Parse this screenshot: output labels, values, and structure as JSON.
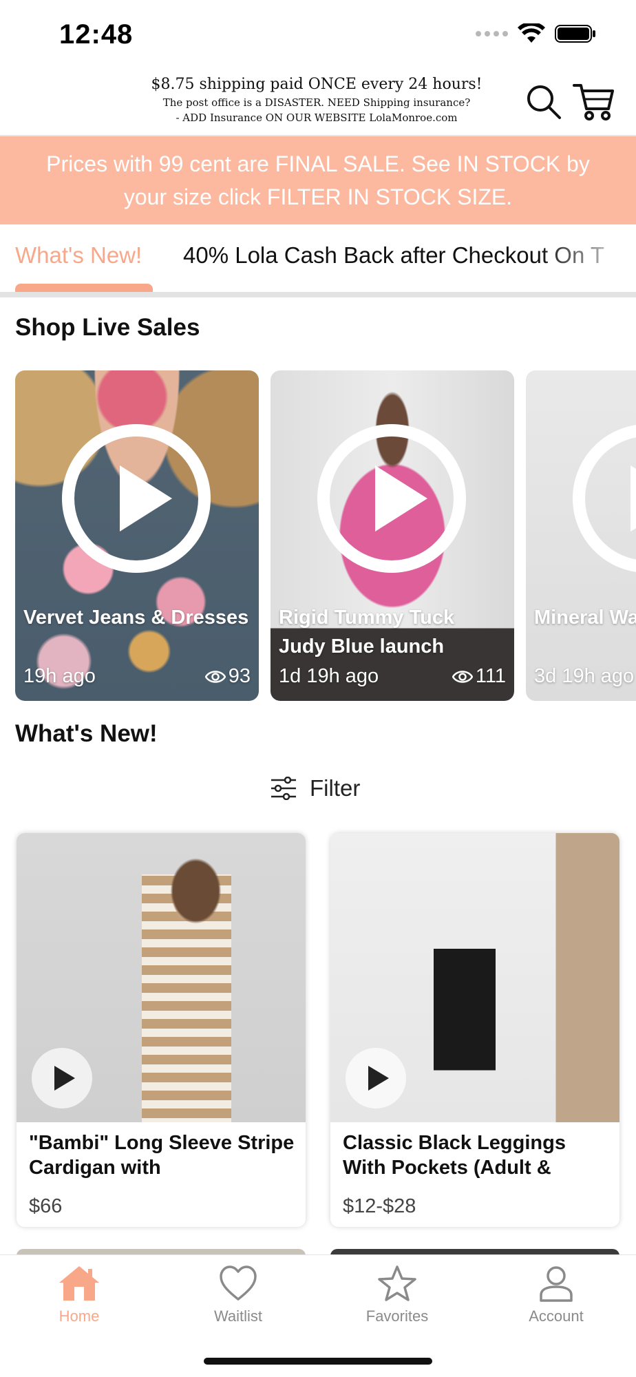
{
  "status_bar": {
    "time": "12:48"
  },
  "header": {
    "banner_line1": "$8.75 shipping paid ONCE every 24 hours!",
    "banner_line2": "The post office is a DISASTER. NEED Shipping insurance?",
    "banner_line3": "- ADD Insurance ON OUR WEBSITE LolaMonroe.com",
    "search_icon": "search-icon",
    "cart_icon": "cart-icon"
  },
  "promo": {
    "text": "Prices with 99 cent are FINAL SALE. See IN STOCK by your size click FILTER IN STOCK SIZE."
  },
  "tabs": [
    {
      "label": "What's New!",
      "active": true
    },
    {
      "label": "40% Lola Cash Back after Checkout On T",
      "active": false
    }
  ],
  "live_sales": {
    "title": "Shop Live Sales",
    "cards": [
      {
        "title": "Vervet Jeans & Dresses",
        "time": "19h ago",
        "views": "93"
      },
      {
        "title": "Rigid Tummy Tuck Judy Blue launch",
        "time": "1d 19h ago",
        "views": "111"
      },
      {
        "title": "Mineral Wa Control jea",
        "time": "3d 19h ago",
        "views": ""
      }
    ]
  },
  "whats_new": {
    "title": "What's New!",
    "filter_label": "Filter",
    "products": [
      {
        "name": "\"Bambi\" Long Sleeve Stripe Cardigan with",
        "price": "$66"
      },
      {
        "name": "Classic Black Leggings With Pockets (Adult &",
        "price": "$12-$28"
      }
    ]
  },
  "bottom_nav": [
    {
      "label": "Home",
      "icon": "home-icon",
      "active": true
    },
    {
      "label": "Waitlist",
      "icon": "heart-icon",
      "active": false
    },
    {
      "label": "Favorites",
      "icon": "star-icon",
      "active": false
    },
    {
      "label": "Account",
      "icon": "person-icon",
      "active": false
    }
  ],
  "colors": {
    "accent": "#f8a889",
    "promo_bg": "#fcb9a0",
    "inactive": "#8a8a8a"
  }
}
